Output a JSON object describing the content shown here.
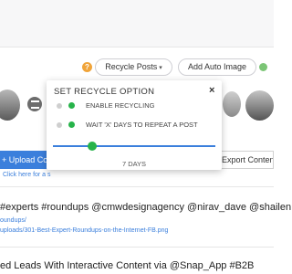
{
  "toolbar": {
    "help_icon": "?",
    "recycle_label": "Recycle Posts",
    "auto_image_label": "Add Auto Image"
  },
  "recycle_modal": {
    "title": "SET RECYCLE OPTION",
    "close": "×",
    "option_1": "ENABLE RECYCLING",
    "option_2": "WAIT 'X' DAYS TO REPEAT A POST",
    "slider_value": "7 DAYS",
    "colors": {
      "active": "#27b34a",
      "track": "#3b7fdc"
    }
  },
  "actions": {
    "upload_label": "+ Upload Co",
    "click_text": "Click here for a s",
    "export_label": "Export Content"
  },
  "posts": [
    {
      "text": "#experts #roundups @cmwdesignagency @nirav_dave @shailen",
      "url_1": "oundups/",
      "url_2": "uploads/301-Best-Expert-Roundups-on-the-Internet-FB.png"
    },
    {
      "text": "ed Leads With Interactive Content via @Snap_App #B2B"
    }
  ]
}
